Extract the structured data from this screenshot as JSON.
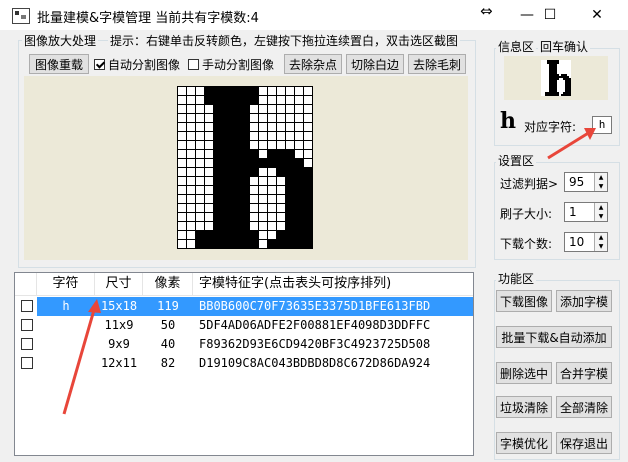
{
  "window": {
    "title": "批量建模&字模管理   当前共有字模数:4",
    "controls": {
      "restore": "⇔",
      "minimize": "—",
      "maximize": "☐",
      "close": "✕"
    }
  },
  "zoom_group": {
    "title": "图像放大处理",
    "hint": "提示：右键单击反转颜色，左键按下拖拉连续置白，双击选区截图",
    "buttons": {
      "reload": "图像重载",
      "remove_noise": "去除杂点",
      "trim_white": "切除白边",
      "remove_burr": "去除毛刺"
    },
    "auto_split": {
      "label": "自动分割图像",
      "checked": true
    },
    "manual_split": {
      "label": "手动分割图像",
      "checked": false
    }
  },
  "glyph": {
    "cols": 15,
    "rows": 18,
    "pixels": [
      "000111111000000",
      "000111111000000",
      "000011110000000",
      "000011110000000",
      "000011110000000",
      "000011110000000",
      "000011110000000",
      "000011111011100",
      "000011111111110",
      "000011111001111",
      "000011110000111",
      "000011110000111",
      "000011110000111",
      "000011110000111",
      "000011110000111",
      "000011110000111",
      "001111111001111",
      "001111111011111"
    ]
  },
  "info": {
    "title": "信息区",
    "confirm": "回车确认",
    "glyph_char": "h",
    "char_label": "对应字符:",
    "char_value": "h"
  },
  "settings": {
    "title": "设置区",
    "threshold_label": "过滤判据>",
    "threshold": "95",
    "brush_label": "刷子大小:",
    "brush": "1",
    "download_label": "下载个数:",
    "download": "10"
  },
  "functions": {
    "title": "功能区",
    "buttons": {
      "download_image": "下载图像",
      "add_glyph": "添加字模",
      "batch": "批量下载&自动添加",
      "delete_selected": "删除选中",
      "merge": "合并字模",
      "trash": "垃圾清除",
      "clear_all": "全部清除",
      "optimize": "字模优化",
      "save_exit": "保存退出"
    }
  },
  "table": {
    "headers": [
      "字符",
      "尺寸",
      "像素",
      "字模特征字(点击表头可按序排列)"
    ],
    "rows": [
      {
        "char": "h",
        "size": "15x18",
        "pixels": "119",
        "feature": "BB0B600C70F73635E3375D1BFE613FBD",
        "selected": true
      },
      {
        "char": "",
        "size": "11x9",
        "pixels": "50",
        "feature": "5DF4AD06ADFE2F00881EF4098D3DDFFC",
        "selected": false
      },
      {
        "char": "",
        "size": "9x9",
        "pixels": "40",
        "feature": "F89362D93E6CD9420BF3C4923725D508",
        "selected": false
      },
      {
        "char": "",
        "size": "12x11",
        "pixels": "82",
        "feature": "D19109C8AC043BDBD8D8C672D86DA924",
        "selected": false
      }
    ]
  },
  "colors": {
    "selection": "#3399ff",
    "arrow": "#e8463a",
    "panel": "#ece9d8"
  }
}
